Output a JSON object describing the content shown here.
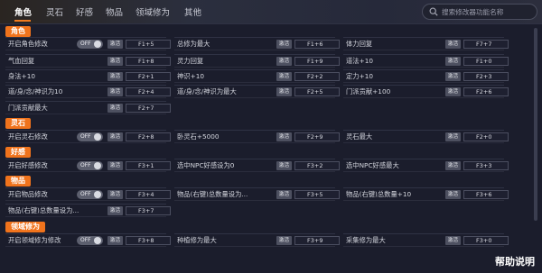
{
  "tabs": [
    "角色",
    "灵石",
    "好感",
    "物品",
    "领域修为",
    "其他"
  ],
  "active_tab": 0,
  "search": {
    "placeholder": "搜索修改器功能名称"
  },
  "toggle_off": "OFF",
  "activate": "激活",
  "help": "帮助说明",
  "colors": {
    "accent": "#f0731c",
    "background": "#1b1d2c"
  },
  "sections": [
    {
      "title": "角色",
      "rows": [
        [
          {
            "label": "开启角色修改",
            "toggle": true,
            "hotkey": "F1+5"
          },
          {
            "label": "总修为最大",
            "hotkey": "F1+6"
          },
          {
            "label": "体力回复",
            "hotkey": "F7+7"
          }
        ],
        [
          {
            "label": "气血回复",
            "hotkey": "F1+8"
          },
          {
            "label": "灵力回复",
            "hotkey": "F1+9"
          },
          {
            "label": "道法+10",
            "hotkey": "F1+0"
          }
        ],
        [
          {
            "label": "身法+10",
            "hotkey": "F2+1"
          },
          {
            "label": "神识+10",
            "hotkey": "F2+2"
          },
          {
            "label": "定力+10",
            "hotkey": "F2+3"
          }
        ],
        [
          {
            "label": "道/身/念/神识为10",
            "hotkey": "F2+4"
          },
          {
            "label": "道/身/念/神识为最大",
            "hotkey": "F2+5"
          },
          {
            "label": "门派贡献+100",
            "hotkey": "F2+6"
          }
        ],
        [
          {
            "label": "门派贡献最大",
            "hotkey": "F2+7"
          }
        ]
      ]
    },
    {
      "title": "灵石",
      "rows": [
        [
          {
            "label": "开启灵石修改",
            "toggle": true,
            "hotkey": "F2+8"
          },
          {
            "label": "卧灵石+5000",
            "hotkey": "F2+9"
          },
          {
            "label": "灵石最大",
            "hotkey": "F2+0"
          }
        ]
      ]
    },
    {
      "title": "好感",
      "rows": [
        [
          {
            "label": "开启好感修改",
            "toggle": true,
            "hotkey": "F3+1"
          },
          {
            "label": "选中NPC好感设为0",
            "hotkey": "F3+2"
          },
          {
            "label": "选中NPC好感最大",
            "hotkey": "F3+3"
          }
        ]
      ]
    },
    {
      "title": "物品",
      "rows": [
        [
          {
            "label": "开启物品修改",
            "toggle": true,
            "hotkey": "F3+4"
          },
          {
            "label": "物品(右键)总数量设为...",
            "hotkey": "F3+5"
          },
          {
            "label": "物品(右键)总数量+10",
            "hotkey": "F3+6"
          }
        ],
        [
          {
            "label": "物品(右键)总数量设为...",
            "hotkey": "F3+7"
          }
        ]
      ]
    },
    {
      "title": "领域修为",
      "rows": [
        [
          {
            "label": "开启领域修为修改",
            "toggle": true,
            "hotkey": "F3+8"
          },
          {
            "label": "种植修为最大",
            "hotkey": "F3+9"
          },
          {
            "label": "采集修为最大",
            "hotkey": "F3+0"
          }
        ]
      ]
    }
  ]
}
